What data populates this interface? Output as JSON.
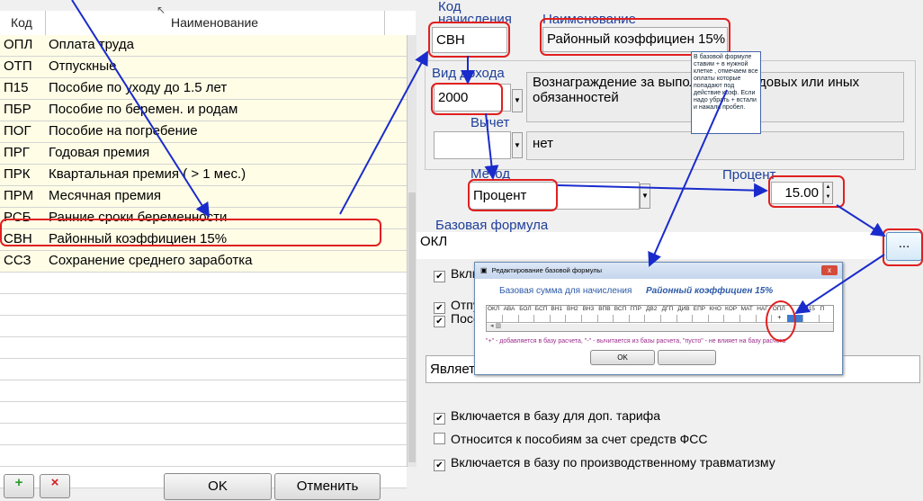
{
  "table": {
    "headers": [
      "Код",
      "Наименование"
    ],
    "rows": [
      {
        "code": "ОПЛ",
        "name": "Оплата труда"
      },
      {
        "code": "ОТП",
        "name": "Отпускные"
      },
      {
        "code": "П15",
        "name": "Пособие по уходу до 1.5 лет"
      },
      {
        "code": "ПБР",
        "name": "Пособие по беремен. и родам"
      },
      {
        "code": "ПОГ",
        "name": "Пособие на погребение"
      },
      {
        "code": "ПРГ",
        "name": "Годовая премия"
      },
      {
        "code": "ПРК",
        "name": "Квартальная премия ( > 1 мес.)"
      },
      {
        "code": "ПРМ",
        "name": "Месячная премия"
      },
      {
        "code": "РСБ",
        "name": "Ранние сроки беременности"
      },
      {
        "code": "СВН",
        "name": "Районный коэффициен 15%"
      },
      {
        "code": "ССЗ",
        "name": "Сохранение среднего заработка"
      }
    ]
  },
  "bottom_buttons": {
    "add": "+",
    "delete": "×",
    "ok": "OK",
    "cancel": "Отменить"
  },
  "form": {
    "code_label": "Код начисления",
    "code_value": "СВН",
    "name_label": "Наименование",
    "name_value": "Районный коэффициен 15%",
    "income_label": "Вид дохода",
    "income_value": "2000",
    "income_desc": "Вознаграждение за выполнение трудовых или иных обязанностей",
    "deduction_label": "Вычет",
    "deduction_value": "",
    "deduction_desc": "нет",
    "method_label": "Метод",
    "method_value": "Процент",
    "percent_label": "Процент",
    "percent_value": "15.00",
    "formula_label": "Базовая формула",
    "formula_value": "ОКЛ",
    "formula_button": "...",
    "partial_text": "Является",
    "checks_top": [
      {
        "label": "Вклю",
        "checked": true
      },
      {
        "label": "Отпу",
        "checked": true
      },
      {
        "label": "Посо",
        "checked": true
      }
    ],
    "checks_bottom": [
      {
        "label": "Включается в базу  для доп. тарифа",
        "checked": true
      },
      {
        "label": "Относится к пособиям за счет средств ФСС",
        "checked": false
      },
      {
        "label": "Включается в базу по производственному травматизму",
        "checked": true
      }
    ]
  },
  "note": "В базовой формуле ставим + в нужной клетке , отмечаем все оплаты которые попадают под действие коэф.  Если надо убрать + встали и нажали пробел.",
  "dialog": {
    "title": "Редактирование базовой формулы",
    "base_label": "Базовая сумма для   начисления",
    "accrual_name": "Районный коэффициен 15%",
    "codes": [
      "ОКЛ",
      "АВА",
      "БОЛ",
      "БСП",
      "ВН1",
      "ВН2",
      "ВН3",
      "ВПВ",
      "ВСП",
      "ГПР",
      "ДВ2",
      "ДГП",
      "ДИВ",
      "ЕПР",
      "КНО",
      "КОР",
      "МАТ",
      "НАГ",
      "ОПЛ",
      "",
      "П15",
      "П"
    ],
    "plus_mark": "+",
    "hint": "\"+\" - добавляется в базу расчета, \"-\" - вычитается из базы расчета, \"пусто\" - не влияет на базу расчета",
    "ok": "OK",
    "close": "x"
  },
  "colors": {
    "accent_red": "#e02020",
    "arrow_blue": "#1a2bcc",
    "label_blue": "#1f3f9a",
    "row_yellow": "#fffde6"
  }
}
